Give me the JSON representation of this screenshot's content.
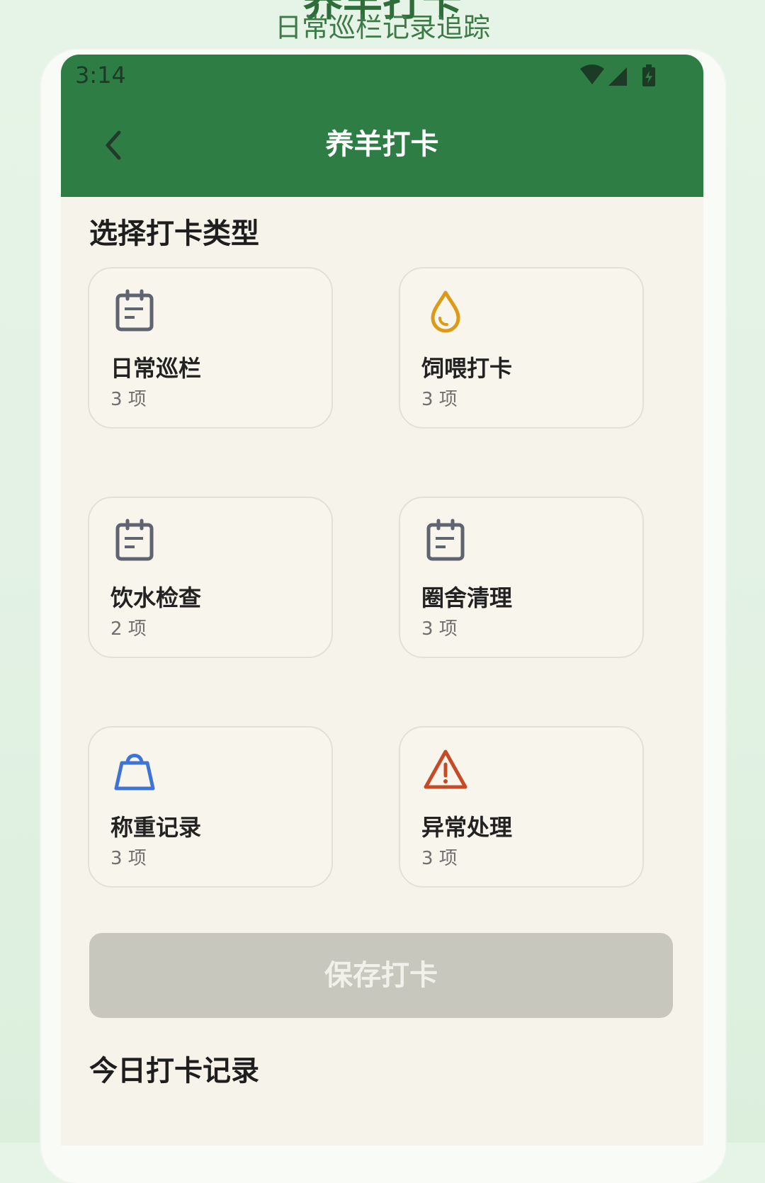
{
  "promo": {
    "heading": "养羊打卡",
    "subheading": "日常巡栏记录追踪"
  },
  "status_bar": {
    "time": "3:14",
    "icons": [
      "wifi-icon",
      "cellular-signal-icon",
      "battery-charging-icon"
    ]
  },
  "app_bar": {
    "back_icon": "chevron-left-icon",
    "title": "养羊打卡",
    "color": "#2e7d45"
  },
  "section_choose": {
    "title": "选择打卡类型"
  },
  "cards": [
    {
      "label": "日常巡栏",
      "count": "3 项",
      "icon": "clipboard-icon",
      "icon_color": "#5f6470"
    },
    {
      "label": "饲喂打卡",
      "count": "3 项",
      "icon": "droplet-icon",
      "icon_color": "#dd9a17"
    },
    {
      "label": "饮水检查",
      "count": "2 项",
      "icon": "clipboard-icon",
      "icon_color": "#5f6470"
    },
    {
      "label": "圈舍清理",
      "count": "3 项",
      "icon": "clipboard-icon",
      "icon_color": "#5f6470"
    },
    {
      "label": "称重记录",
      "count": "3 项",
      "icon": "bag-icon",
      "icon_color": "#3f73d6"
    },
    {
      "label": "异常处理",
      "count": "3 项",
      "icon": "warning-icon",
      "icon_color": "#c64a25"
    }
  ],
  "save_button": {
    "label": "保存打卡",
    "disabled": true
  },
  "section_today": {
    "title": "今日打卡记录"
  }
}
